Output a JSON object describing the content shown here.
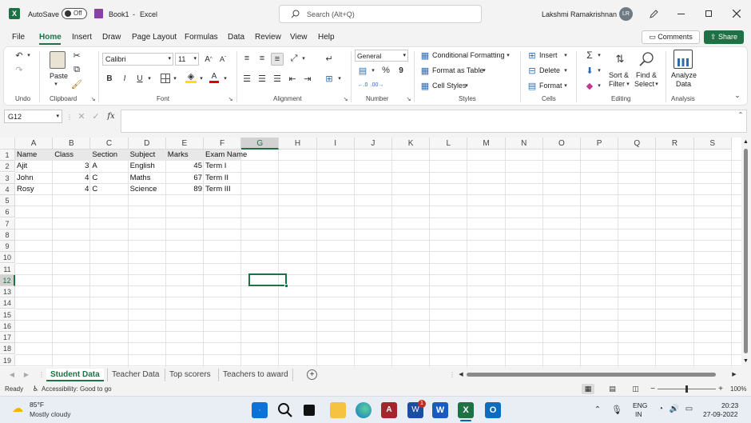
{
  "titlebar": {
    "excel_badge": "X",
    "autosave_label": "AutoSave",
    "autosave_state": "Off",
    "book_name": "Book1",
    "sep": "-",
    "app_name": "Excel",
    "search_placeholder": "Search (Alt+Q)",
    "user_name": "Lakshmi Ramakrishnan",
    "user_initials": "LR"
  },
  "menu": {
    "items": [
      "File",
      "Home",
      "Insert",
      "Draw",
      "Page Layout",
      "Formulas",
      "Data",
      "Review",
      "View",
      "Help"
    ],
    "active": "Home",
    "comments_label": "Comments",
    "share_label": "Share"
  },
  "ribbon": {
    "groups": [
      "Undo",
      "Clipboard",
      "Font",
      "Alignment",
      "Number",
      "Styles",
      "Cells",
      "Editing",
      "Analysis"
    ],
    "paste_label": "Paste",
    "font_name": "Calibri",
    "font_size": "11",
    "bold": "B",
    "italic": "I",
    "underline": "U",
    "number_format": "General",
    "percent": "%",
    "comma": "9",
    "conditional_formatting": "Conditional Formatting",
    "format_as_table": "Format as Table",
    "cell_styles": "Cell Styles",
    "insert": "Insert",
    "delete": "Delete",
    "format": "Format",
    "sort_filter": [
      "Sort &",
      "Filter"
    ],
    "find_select": [
      "Find &",
      "Select"
    ],
    "analyze_data": [
      "Analyze",
      "Data"
    ]
  },
  "formula": {
    "name_box": "G12",
    "fx": "fx",
    "value": ""
  },
  "columns": [
    "A",
    "B",
    "C",
    "D",
    "E",
    "F",
    "G",
    "H",
    "I",
    "J",
    "K",
    "L",
    "M",
    "N",
    "O",
    "P",
    "Q",
    "R",
    "S"
  ],
  "rows": [
    "1",
    "2",
    "3",
    "4",
    "5",
    "6",
    "7",
    "8",
    "9",
    "10",
    "11",
    "12",
    "13",
    "14",
    "15",
    "16",
    "17",
    "18",
    "19"
  ],
  "cells": {
    "header": [
      "Name",
      "Class",
      "Section",
      "Subject",
      "Marks",
      "Exam Name"
    ],
    "data": [
      [
        "Ajit",
        "3",
        "A",
        "English",
        "45",
        "Term I"
      ],
      [
        "John",
        "4",
        "C",
        "Maths",
        "67",
        "Term II"
      ],
      [
        "Rosy",
        "4",
        "C",
        "Science",
        "89",
        "Term III"
      ]
    ]
  },
  "sheets": {
    "tabs": [
      "Student Data",
      "Teacher Data",
      "Top scorers",
      "Teachers to award"
    ],
    "active": "Student Data"
  },
  "status": {
    "mode": "Ready",
    "accessibility": "Accessibility: Good to go",
    "zoom": "100%"
  },
  "taskbar": {
    "weather_temp": "85°F",
    "weather_desc": "Mostly cloudy",
    "lang": "ENG",
    "region": "IN",
    "time": "20:23",
    "date": "27-09-2022",
    "word_badge": "1"
  }
}
